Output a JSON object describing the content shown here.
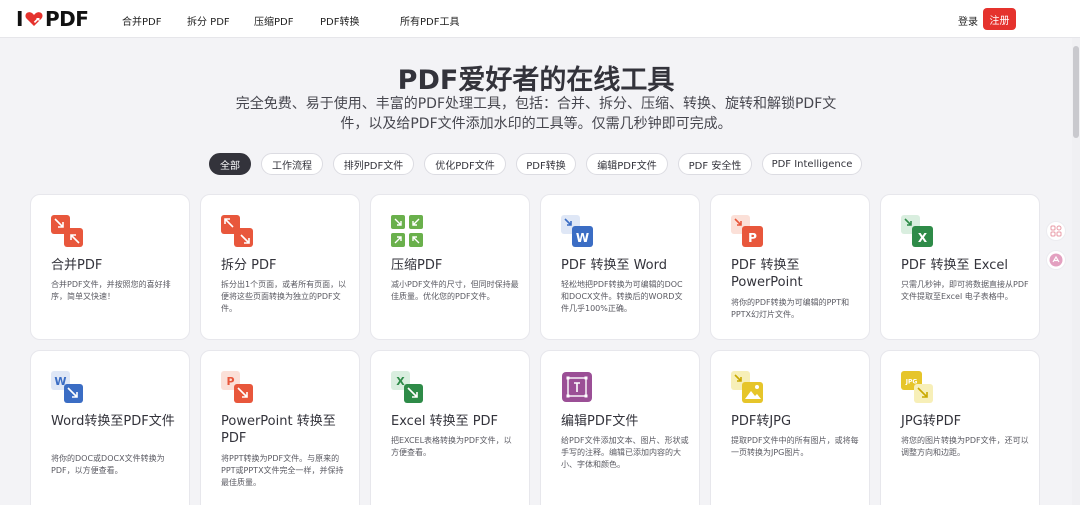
{
  "header": {
    "logo_left": "I",
    "logo_right": "PDF",
    "nav": [
      "合并PDF",
      "拆分 PDF",
      "压缩PDF",
      "PDF转换",
      "所有PDF工具"
    ],
    "login": "登录",
    "signup": "注册"
  },
  "hero": {
    "title": "PDF爱好者的在线工具",
    "subtitle": "完全免费、易于使用、丰富的PDF处理工具，包括：合并、拆分、压缩、转换、旋转和解锁PDF文件，以及给PDF文件添加水印的工具等。仅需几秒钟即可完成。"
  },
  "filters": {
    "items": [
      "全部",
      "工作流程",
      "排列PDF文件",
      "优化PDF文件",
      "PDF转换",
      "编辑PDF文件",
      "PDF 安全性",
      "PDF Intelligence"
    ],
    "active": "全部"
  },
  "tools": [
    {
      "title": "合并PDF",
      "desc": "合并PDF文件，并按照您的喜好排序，简单又快速！",
      "icon": "merge-icon",
      "color": "#e8573c"
    },
    {
      "title": "拆分 PDF",
      "desc": "拆分出1个页面，或者所有页面，以便将这些页面转换为独立的PDF文件。",
      "icon": "split-icon",
      "color": "#e8573c"
    },
    {
      "title": "压缩PDF",
      "desc": "减小PDF文件的尺寸，但同时保持最佳质量。优化您的PDF文件。",
      "icon": "compress-icon",
      "color": "#6ab04c"
    },
    {
      "title": "PDF 转换至 Word",
      "desc": "轻松地把PDF转换为可编辑的DOC和DOCX文件。转换后的WORD文件几乎100%正确。",
      "icon": "pdf-to-word-icon",
      "color": "#3b6dc4"
    },
    {
      "title": "PDF 转换至 PowerPoint",
      "desc": "将你的PDF转换为可编辑的PPT和PPTX幻灯片文件。",
      "icon": "pdf-to-powerpoint-icon",
      "color": "#e8573c"
    },
    {
      "title": "PDF 转换至 Excel",
      "desc": "只需几秒钟，即可将数据直接从PDF文件提取至Excel 电子表格中。",
      "icon": "pdf-to-excel-icon",
      "color": "#2e8b48"
    },
    {
      "title": "Word转换至PDF文件",
      "desc": "将你的DOC或DOCX文件转换为PDF，以方便查看。",
      "icon": "word-to-pdf-icon",
      "color": "#3b6dc4"
    },
    {
      "title": "PowerPoint 转换至 PDF",
      "desc": "将PPT转换为PDF文件。与原来的PPT或PPTX文件完全一样，并保持最佳质量。",
      "icon": "powerpoint-to-pdf-icon",
      "color": "#e8573c"
    },
    {
      "title": "Excel 转换至 PDF",
      "desc": "把EXCEL表格转换为PDF文件，以方便查看。",
      "icon": "excel-to-pdf-icon",
      "color": "#2e8b48"
    },
    {
      "title": "编辑PDF文件",
      "desc": "给PDF文件添加文本、图片、形状或手写的注释。编辑已添加内容的大小、字体和颜色。",
      "icon": "edit-pdf-icon",
      "color": "#9b4f96"
    },
    {
      "title": "PDF转JPG",
      "desc": "提取PDF文件中的所有图片，或将每一页转换为JPG图片。",
      "icon": "pdf-to-jpg-icon",
      "color": "#e6c52a"
    },
    {
      "title": "JPG转PDF",
      "desc": "将您的图片转换为PDF文件，还可以调整方向和边距。",
      "icon": "jpg-to-pdf-icon",
      "color": "#e6c52a"
    }
  ]
}
